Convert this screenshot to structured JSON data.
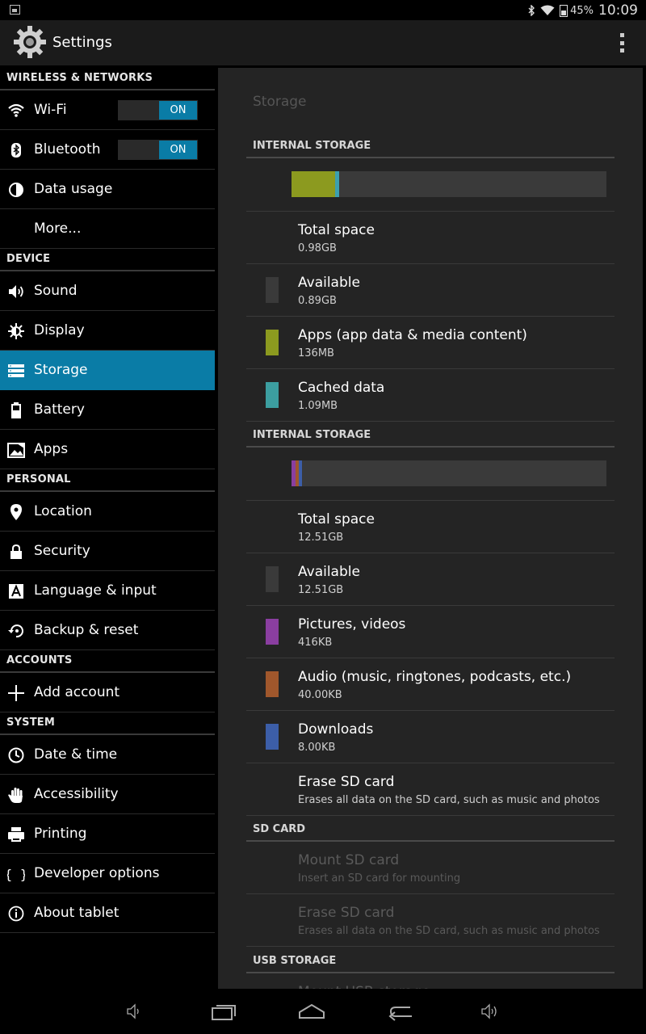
{
  "status_bar": {
    "battery_pct": "45%",
    "time": "10:09"
  },
  "action_bar": {
    "title": "Settings"
  },
  "nav": {
    "groups": [
      {
        "header": "WIRELESS & NETWORKS",
        "items": [
          {
            "label": "Wi-Fi",
            "icon": "wifi-icon",
            "toggle": "ON"
          },
          {
            "label": "Bluetooth",
            "icon": "bluetooth-icon",
            "toggle": "ON"
          },
          {
            "label": "Data usage",
            "icon": "data-usage-icon"
          },
          {
            "label": "More...",
            "icon": ""
          }
        ]
      },
      {
        "header": "DEVICE",
        "items": [
          {
            "label": "Sound",
            "icon": "sound-icon"
          },
          {
            "label": "Display",
            "icon": "display-icon"
          },
          {
            "label": "Storage",
            "icon": "storage-icon",
            "selected": true
          },
          {
            "label": "Battery",
            "icon": "battery-icon"
          },
          {
            "label": "Apps",
            "icon": "apps-icon"
          }
        ]
      },
      {
        "header": "PERSONAL",
        "items": [
          {
            "label": "Location",
            "icon": "location-icon"
          },
          {
            "label": "Security",
            "icon": "lock-icon"
          },
          {
            "label": "Language & input",
            "icon": "language-icon"
          },
          {
            "label": "Backup & reset",
            "icon": "backup-icon"
          }
        ]
      },
      {
        "header": "ACCOUNTS",
        "items": [
          {
            "label": "Add account",
            "icon": "plus-icon"
          }
        ]
      },
      {
        "header": "SYSTEM",
        "items": [
          {
            "label": "Date & time",
            "icon": "clock-icon"
          },
          {
            "label": "Accessibility",
            "icon": "hand-icon"
          },
          {
            "label": "Printing",
            "icon": "printer-icon"
          },
          {
            "label": "Developer options",
            "icon": "braces-icon"
          },
          {
            "label": "About tablet",
            "icon": "info-icon"
          }
        ]
      }
    ]
  },
  "pane": {
    "title": "Storage",
    "sections": [
      {
        "header": "INTERNAL STORAGE",
        "bar": [
          {
            "color": "#8c9a1f",
            "fraction": 0.138
          },
          {
            "color": "#3ca0b0",
            "fraction": 0.014
          }
        ],
        "rows": [
          {
            "primary": "Total space",
            "secondary": "0.98GB"
          },
          {
            "primary": "Available",
            "secondary": "0.89GB",
            "swatch": "#3a3a3a"
          },
          {
            "primary": "Apps (app data & media content)",
            "secondary": "136MB",
            "swatch": "#8c9a1f"
          },
          {
            "primary": "Cached data",
            "secondary": "1.09MB",
            "swatch": "#3c9ea0"
          }
        ]
      },
      {
        "header": "INTERNAL STORAGE",
        "bar": [
          {
            "color": "#8a3ea0",
            "fraction": 0.012
          },
          {
            "color": "#a0572c",
            "fraction": 0.01
          },
          {
            "color": "#3c5ea8",
            "fraction": 0.012
          }
        ],
        "rows": [
          {
            "primary": "Total space",
            "secondary": "12.51GB"
          },
          {
            "primary": "Available",
            "secondary": "12.51GB",
            "swatch": "#3a3a3a"
          },
          {
            "primary": "Pictures, videos",
            "secondary": "416KB",
            "swatch": "#8a3ea0"
          },
          {
            "primary": "Audio (music, ringtones, podcasts, etc.)",
            "secondary": "40.00KB",
            "swatch": "#a0572c"
          },
          {
            "primary": "Downloads",
            "secondary": "8.00KB",
            "swatch": "#3c5ea8"
          },
          {
            "primary": "Erase SD card",
            "secondary": "Erases all data on the SD card, such as music and photos"
          }
        ]
      },
      {
        "header": "SD CARD",
        "rows": [
          {
            "primary": "Mount SD card",
            "secondary": "Insert an SD card for mounting",
            "disabled": true
          },
          {
            "primary": "Erase SD card",
            "secondary": "Erases all data on the SD card, such as music and photos",
            "disabled": true
          }
        ]
      },
      {
        "header": "USB STORAGE",
        "rows": [
          {
            "primary": "Mount USB storage",
            "secondary": "",
            "disabled": true
          }
        ]
      }
    ]
  }
}
